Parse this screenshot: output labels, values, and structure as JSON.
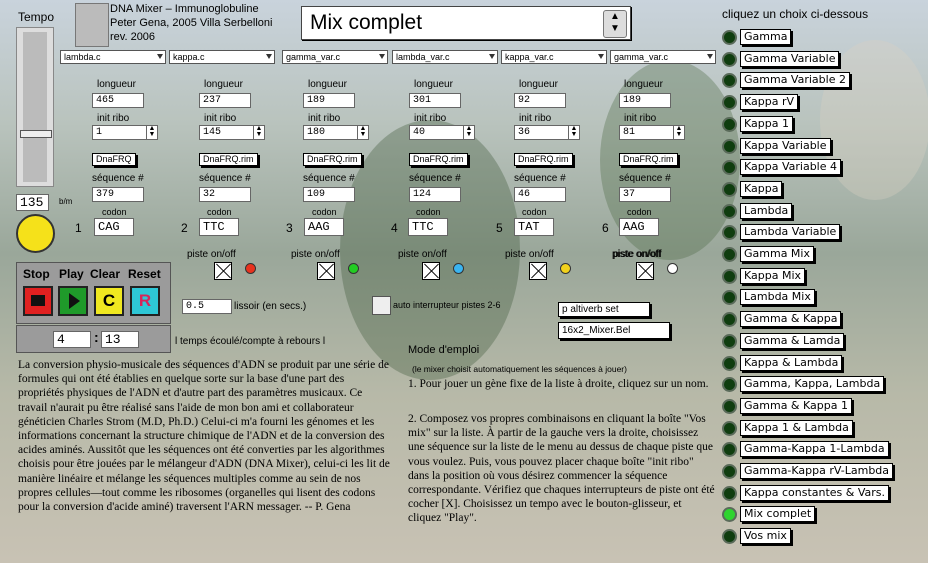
{
  "header": {
    "tempo_label": "Tempo",
    "app_line1": "DNA Mixer – Immunoglobuline",
    "app_line2": "Peter Gena, 2005 Villa Serbelloni",
    "app_line3": "rev. 2006",
    "mix_title": "Mix complet",
    "choose_label": "cliquez un choix ci-dessous"
  },
  "tempo": {
    "value": "135",
    "unit": "b/m",
    "slider_level": 0.32
  },
  "tracks": [
    {
      "gene": "lambda.c",
      "length": "465",
      "ribo": "1",
      "file": "DnaFRQ",
      "seq": "379",
      "index": "1",
      "codon": "CAG",
      "led_color": "#e8321e"
    },
    {
      "gene": "kappa.c",
      "length": "237",
      "ribo": "145",
      "file": "DnaFRQ.rim",
      "seq": "32",
      "index": "2",
      "codon": "TTC",
      "led_color": "#22cc22"
    },
    {
      "gene": "gamma_var.c",
      "length": "189",
      "ribo": "180",
      "file": "DnaFRQ.rim",
      "seq": "109",
      "index": "3",
      "codon": "AAG",
      "led_color": "#3ab4f0"
    },
    {
      "gene": "lambda_var.c",
      "length": "301",
      "ribo": "40",
      "file": "DnaFRQ.rim",
      "seq": "124",
      "index": "4",
      "codon": "TTC",
      "led_color": "#f2d21c"
    },
    {
      "gene": "kappa_var.c",
      "length": "92",
      "ribo": "36",
      "file": "DnaFRQ.rim",
      "seq": "46",
      "index": "5",
      "codon": "TAT",
      "led_color": "#ffffff"
    },
    {
      "gene": "gamma_var.c",
      "length": "189",
      "ribo": "81",
      "file": "DnaFRQ.rim",
      "seq": "37",
      "index": "6",
      "codon": "AAG",
      "led_color": "#ffffff"
    }
  ],
  "track_labels": {
    "length": "longueur",
    "ribo": "init ribo",
    "seq": "séquence #",
    "codon": "codon",
    "piste": "piste on/off"
  },
  "transport": {
    "stop": "Stop",
    "play": "Play",
    "clear": "Clear",
    "reset": "Reset",
    "btn_c": "C",
    "btn_r": "R",
    "minutes": "4",
    "seconds": "13",
    "elapsed_label": "l temps écoulé/compte à rebours l"
  },
  "lissoir": {
    "value": "0.5",
    "label": "lissoir (en secs.)"
  },
  "auto_label": "auto interrupteur pistes 2-6",
  "msgs": {
    "altiverb": "p altiverb set",
    "mixer": "16x2_Mixer.Bel"
  },
  "description": "La conversion physio-musicale des séquences d'ADN se produit par une série de formules qui ont été établies en quelque sorte sur la base d'une part des propriétés physiques de l'ADN et d'autre part des paramètres musicaux. Ce travail n'aurait pu être réalisé sans l'aide de mon bon ami et collaborateur généticien Charles Strom (M.D, Ph.D.) Celui-ci m'a fourni les génomes et les informations concernant la structure chimique de l'ADN et de la conversion des acides aminés. Aussitôt que les séquences ont été converties par les algorithmes choisis pour être jouées par le mélangeur d'ADN (DNA Mixer), celui-ci les lit de manière linéaire et mélange les séquences multiples comme au sein de nos propres cellules—tout comme les ribosomes (organelles qui lisent des codons pour la conversion d'acide aminé) traversent l'ARN messager. -- P. Gena",
  "mode": {
    "title": "Mode d'emploi",
    "note": "(le mixer choisit automatiquement les séquences à jouer)",
    "p1": "1. Pour jouer un gène fixe de la liste à droite, cliquez sur un nom.",
    "p2": "2. Composez vos propres combinaisons en cliquant la boîte \"Vos mix\" sur la liste. À partir de la gauche vers la droite, choisissez une séquence sur la liste de le menu au dessus de chaque piste que vous voulez. Puis, vous pouvez placer chaque boîte \"init ribo\" dans la position où vous désirez commencer la séquence correspondante. Vérifiez que chaques interrupteurs de piste ont été cocher [X]. Choisissez un tempo avec le bouton-glisseur, et cliquez \"Play\"."
  },
  "choices": [
    {
      "label": "Gamma",
      "on": false
    },
    {
      "label": "Gamma Variable",
      "on": false
    },
    {
      "label": "Gamma Variable 2",
      "on": false
    },
    {
      "label": "Kappa rV",
      "on": false
    },
    {
      "label": "Kappa 1",
      "on": false
    },
    {
      "label": "Kappa Variable",
      "on": false
    },
    {
      "label": "Kappa Variable 4",
      "on": false
    },
    {
      "label": "Kappa",
      "on": false
    },
    {
      "label": "Lambda",
      "on": false
    },
    {
      "label": "Lambda Variable",
      "on": false
    },
    {
      "label": "Gamma Mix",
      "on": false
    },
    {
      "label": "Kappa Mix",
      "on": false
    },
    {
      "label": "Lambda Mix",
      "on": false
    },
    {
      "label": "Gamma & Kappa",
      "on": false
    },
    {
      "label": "Gamma & Lamda",
      "on": false
    },
    {
      "label": "Kappa & Lambda",
      "on": false
    },
    {
      "label": "Gamma, Kappa, Lambda",
      "on": false
    },
    {
      "label": "Gamma & Kappa 1",
      "on": false
    },
    {
      "label": "Kappa 1 & Lambda",
      "on": false
    },
    {
      "label": "Gamma-Kappa 1-Lambda",
      "on": false
    },
    {
      "label": "Gamma-Kappa rV-Lambda",
      "on": false
    },
    {
      "label": "Kappa constantes & Vars.",
      "on": false
    },
    {
      "label": "Mix complet",
      "on": true
    },
    {
      "label": "Vos mix",
      "on": false
    }
  ]
}
